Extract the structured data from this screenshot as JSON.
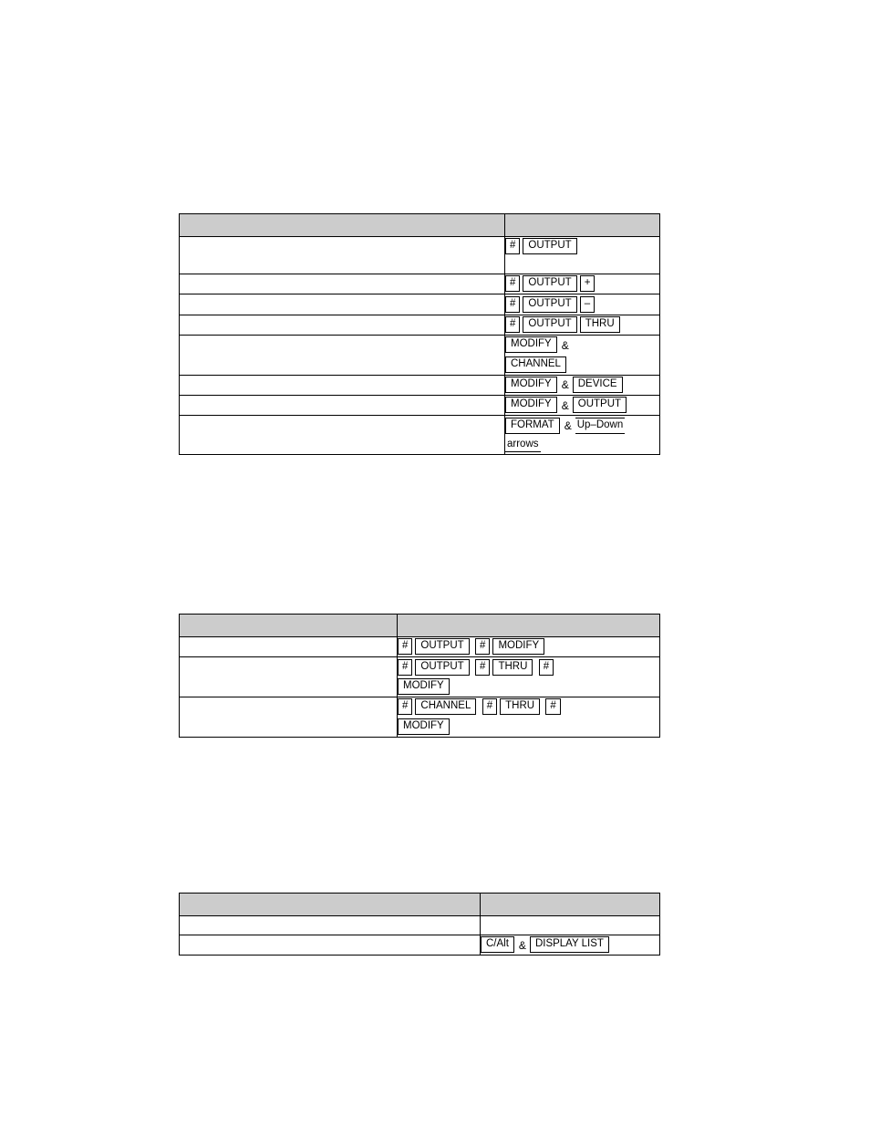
{
  "document": {
    "tables": [
      {
        "id": "table1",
        "header": {
          "col1": "",
          "col2": ""
        },
        "rows": [
          {
            "label": "",
            "keys": [
              {
                "type": "key",
                "text": "#"
              },
              {
                "type": "key",
                "text": "OUTPUT"
              }
            ],
            "tall": true
          },
          {
            "label": "",
            "keys": [
              {
                "type": "key",
                "text": "#"
              },
              {
                "type": "key",
                "text": "OUTPUT"
              },
              {
                "type": "key",
                "text": "+"
              }
            ]
          },
          {
            "label": "",
            "keys": [
              {
                "type": "key",
                "text": "#"
              },
              {
                "type": "key",
                "text": "OUTPUT"
              },
              {
                "type": "key",
                "text": "–"
              }
            ]
          },
          {
            "label": "",
            "keys": [
              {
                "type": "key",
                "text": "#"
              },
              {
                "type": "key",
                "text": "OUTPUT"
              },
              {
                "type": "key",
                "text": "THRU"
              }
            ]
          },
          {
            "label": "",
            "keys": [
              {
                "type": "key",
                "text": "MODIFY"
              },
              {
                "type": "amp",
                "text": "&"
              },
              {
                "type": "key",
                "text": "CHANNEL"
              }
            ]
          },
          {
            "label": "",
            "keys": [
              {
                "type": "key",
                "text": "MODIFY"
              },
              {
                "type": "amp",
                "text": "&"
              },
              {
                "type": "key",
                "text": "DEVICE"
              }
            ]
          },
          {
            "label": "",
            "keys": [
              {
                "type": "key",
                "text": "MODIFY"
              },
              {
                "type": "amp",
                "text": "&"
              },
              {
                "type": "key",
                "text": "OUTPUT"
              }
            ]
          },
          {
            "label": "",
            "keys": [
              {
                "type": "key",
                "text": "FORMAT"
              },
              {
                "type": "amp",
                "text": "&"
              },
              {
                "type": "underlined",
                "text": "Up–Down"
              },
              {
                "type": "contword",
                "text": "arrows"
              }
            ]
          }
        ]
      },
      {
        "id": "table2",
        "header": {
          "col1": "",
          "col2": ""
        },
        "rows": [
          {
            "label": "",
            "keys": [
              {
                "type": "key",
                "text": "#"
              },
              {
                "type": "key",
                "text": "OUTPUT"
              },
              {
                "type": "key",
                "text": "#"
              },
              {
                "type": "key",
                "text": "MODIFY"
              }
            ]
          },
          {
            "label": "",
            "keys": [
              {
                "type": "key",
                "text": "#"
              },
              {
                "type": "key",
                "text": "OUTPUT"
              },
              {
                "type": "key",
                "text": "#"
              },
              {
                "type": "key",
                "text": "THRU"
              },
              {
                "type": "key",
                "text": "#"
              },
              {
                "type": "key",
                "text": "MODIFY"
              }
            ]
          },
          {
            "label": "",
            "keys": [
              {
                "type": "key",
                "text": "#"
              },
              {
                "type": "key",
                "text": "CHANNEL"
              },
              {
                "type": "key",
                "text": "#"
              },
              {
                "type": "key",
                "text": "THRU"
              },
              {
                "type": "key",
                "text": "#"
              },
              {
                "type": "key",
                "text": "MODIFY"
              }
            ]
          }
        ]
      },
      {
        "id": "table3",
        "header": {
          "col1": "",
          "col2": ""
        },
        "rows": [
          {
            "label": "",
            "keys": []
          },
          {
            "label": "",
            "keys": [
              {
                "type": "key",
                "text": "C/Alt"
              },
              {
                "type": "amp",
                "text": "&"
              },
              {
                "type": "key",
                "text": "DISPLAY LIST"
              }
            ]
          }
        ]
      }
    ]
  }
}
